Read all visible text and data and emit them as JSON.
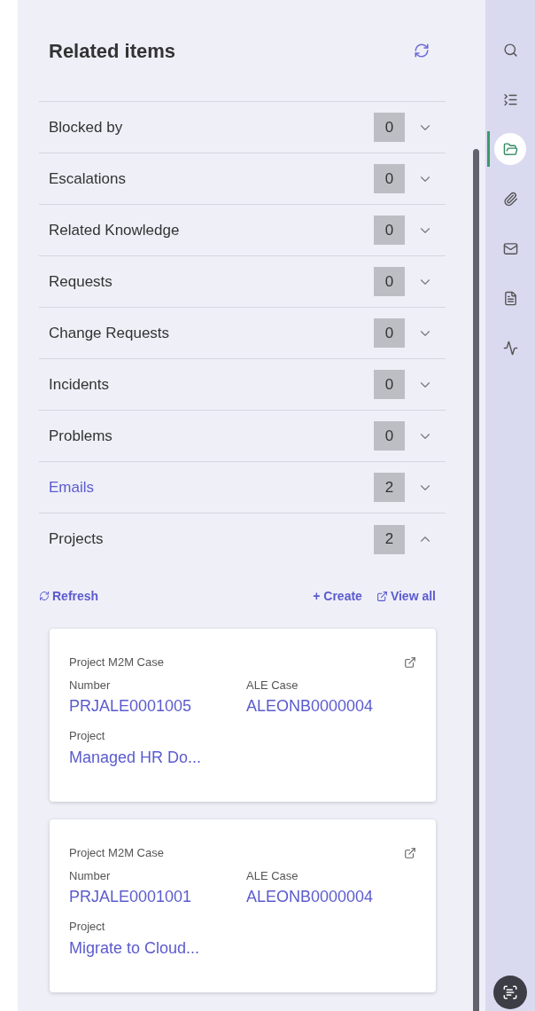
{
  "panel": {
    "title": "Related items"
  },
  "sections": [
    {
      "label": "Blocked by",
      "count": "0",
      "expanded": false,
      "highlighted": false
    },
    {
      "label": "Escalations",
      "count": "0",
      "expanded": false,
      "highlighted": false
    },
    {
      "label": "Related Knowledge",
      "count": "0",
      "expanded": false,
      "highlighted": false
    },
    {
      "label": "Requests",
      "count": "0",
      "expanded": false,
      "highlighted": false
    },
    {
      "label": "Change Requests",
      "count": "0",
      "expanded": false,
      "highlighted": false
    },
    {
      "label": "Incidents",
      "count": "0",
      "expanded": false,
      "highlighted": false
    },
    {
      "label": "Problems",
      "count": "0",
      "expanded": false,
      "highlighted": false
    },
    {
      "label": "Emails",
      "count": "2",
      "expanded": false,
      "highlighted": true
    },
    {
      "label": "Projects",
      "count": "2",
      "expanded": true,
      "highlighted": false
    }
  ],
  "projects_toolbar": {
    "refresh": "Refresh",
    "create": "+ Create",
    "view_all": "View all"
  },
  "cards": [
    {
      "type": "Project M2M Case",
      "number_label": "Number",
      "number": "PRJALE0001005",
      "case_label": "ALE Case",
      "case": "ALEONB0000004",
      "project_label": "Project",
      "project": "Managed HR Do..."
    },
    {
      "type": "Project M2M Case",
      "number_label": "Number",
      "number": "PRJALE0001001",
      "case_label": "ALE Case",
      "case": "ALEONB0000004",
      "project_label": "Project",
      "project": "Migrate to Cloud..."
    }
  ],
  "rail": [
    {
      "kind": "search",
      "selected": false
    },
    {
      "kind": "list",
      "selected": false
    },
    {
      "kind": "folder",
      "selected": true
    },
    {
      "kind": "paperclip",
      "selected": false
    },
    {
      "kind": "mail",
      "selected": false
    },
    {
      "kind": "document",
      "selected": false
    },
    {
      "kind": "pulse",
      "selected": false
    }
  ]
}
